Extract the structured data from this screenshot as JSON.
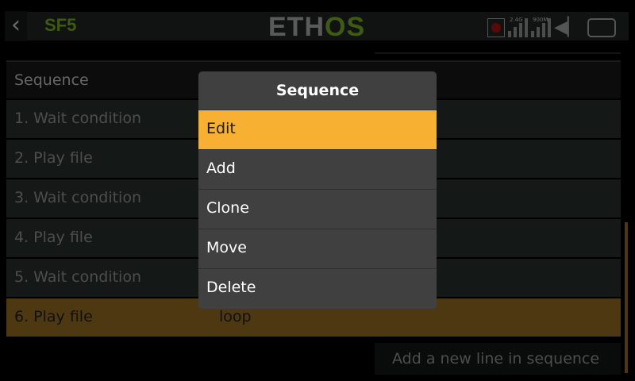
{
  "header": {
    "title": "SF5",
    "logo_left": "ETH",
    "logo_right": "OS",
    "status": {
      "label_24g": "2.4G",
      "label_900m": "900M"
    }
  },
  "list": {
    "header": "Sequence",
    "rows": [
      {
        "label": "1. Wait condition",
        "value": ""
      },
      {
        "label": "2. Play file",
        "value": ""
      },
      {
        "label": "3. Wait condition",
        "value": ""
      },
      {
        "label": "4. Play file",
        "value": ""
      },
      {
        "label": "5. Wait condition",
        "value": ""
      },
      {
        "label": "6. Play file",
        "value": "loop"
      }
    ],
    "add_button": "Add a new line in sequence"
  },
  "menu": {
    "title": "Sequence",
    "items": [
      "Edit",
      "Add",
      "Clone",
      "Move",
      "Delete"
    ],
    "active": "Edit"
  },
  "colors": {
    "accent": "#f7b032",
    "selected_row": "#4d3811",
    "brand_green": "#3f5a12"
  }
}
